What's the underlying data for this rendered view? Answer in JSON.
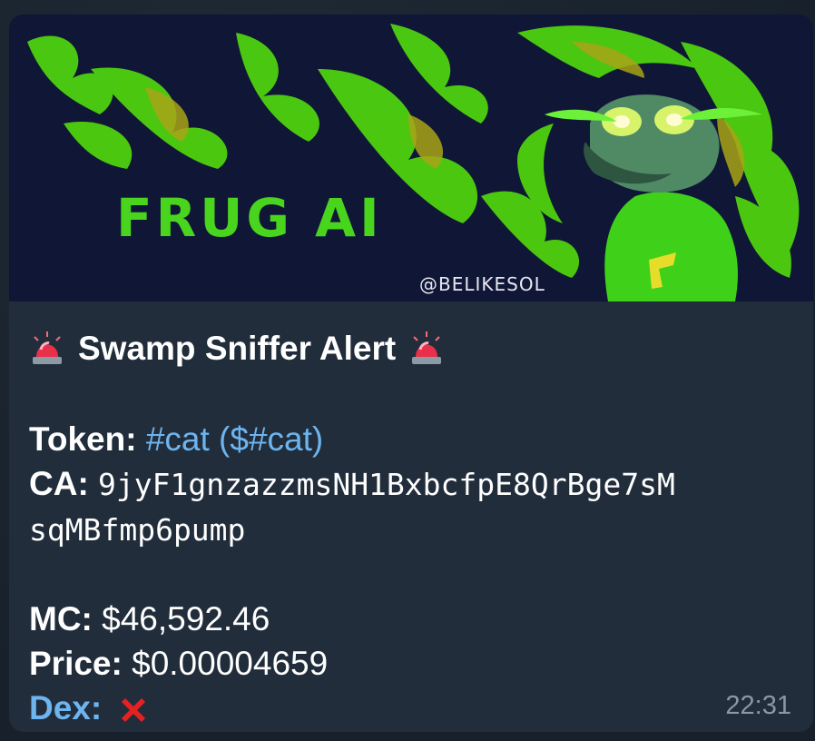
{
  "banner": {
    "title": "FRUG AI",
    "credit": "@BELIKESOL"
  },
  "message": {
    "header": "Swamp Sniffer Alert",
    "token_label": "Token:",
    "token_value": "#cat ($#cat)",
    "ca_label": "CA:",
    "ca_value_line1": "9jyF1gnzazzmsNH1BxbcfpE8QrBge7sM",
    "ca_value_line2": "sqMBfmp6pump",
    "mc_label": "MC:",
    "mc_value": "$46,592.46",
    "price_label": "Price:",
    "price_value": "$0.00004659",
    "dex_label": "Dex:",
    "dex_status_icon": "red-cross-icon",
    "timestamp": "22:31"
  },
  "icons": {
    "siren": "police-light-icon",
    "cross": "red-cross-mark-icon"
  },
  "colors": {
    "bubble": "#212d3b",
    "link": "#6eb4ef",
    "banner_bg": "#0f1636",
    "flame_green": "#5ee21a"
  }
}
